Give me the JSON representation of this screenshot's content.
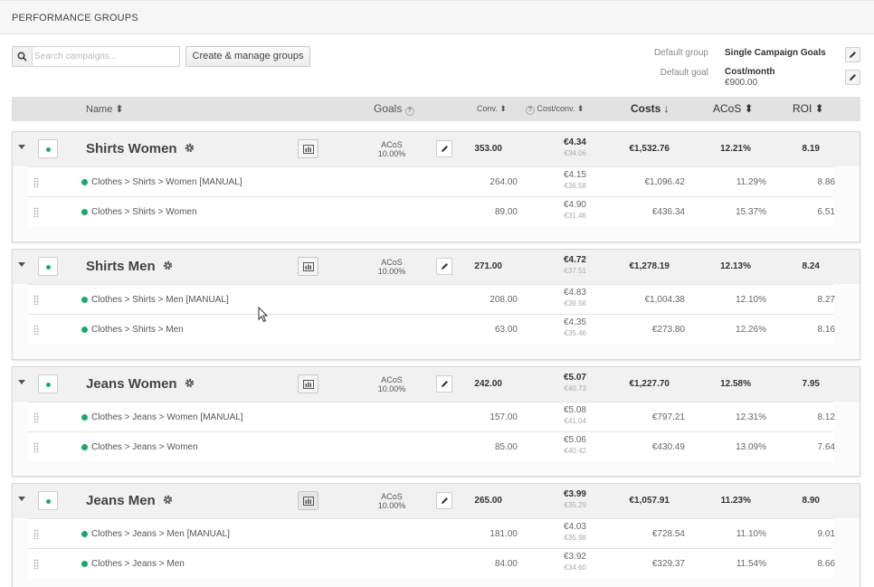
{
  "header": {
    "title": "PERFORMANCE GROUPS"
  },
  "toolbar": {
    "search_placeholder": "Search campaigns...",
    "create_button": "Create & manage groups"
  },
  "defaults": {
    "group_label": "Default group",
    "group_value": "Single Campaign Goals",
    "goal_label": "Default goal",
    "goal_value": "Cost/month",
    "goal_amount": "€900.00"
  },
  "columns": {
    "name": "Name ⬍",
    "goals": "Goals",
    "conv": "Conv. ⬍",
    "cost_conv": "Cost/conv. ⬍",
    "costs": "Costs ↓",
    "acos": "ACoS ⬍",
    "roi": "ROI ⬍"
  },
  "groups": [
    {
      "name": "Shirts Women",
      "goal_label": "ACoS",
      "goal_value": "10.00%",
      "conv": "353.00",
      "cost_conv": "€4.34",
      "cost_conv_sub": "€34.06",
      "costs": "€1,532.76",
      "acos": "12.21%",
      "roi": "8.19",
      "campaigns": [
        {
          "name": "Clothes > Shirts > Women [MANUAL]",
          "conv": "264.00",
          "cost_conv": "€4.15",
          "cost_conv_sub": "€36.58",
          "costs": "€1,096.42",
          "acos": "11.29%",
          "roi": "8.86"
        },
        {
          "name": "Clothes > Shirts > Women",
          "conv": "89.00",
          "cost_conv": "€4.90",
          "cost_conv_sub": "€31.46",
          "costs": "€436.34",
          "acos": "15.37%",
          "roi": "6.51"
        }
      ]
    },
    {
      "name": "Shirts Men",
      "goal_label": "ACoS",
      "goal_value": "10.00%",
      "conv": "271.00",
      "cost_conv": "€4.72",
      "cost_conv_sub": "€37.51",
      "costs": "€1,278.19",
      "acos": "12.13%",
      "roi": "8.24",
      "campaigns": [
        {
          "name": "Clothes > Shirts > Men [MANUAL]",
          "conv": "208.00",
          "cost_conv": "€4.83",
          "cost_conv_sub": "€39.56",
          "costs": "€1,004.38",
          "acos": "12.10%",
          "roi": "8.27"
        },
        {
          "name": "Clothes > Shirts > Men",
          "conv": "63.00",
          "cost_conv": "€4.35",
          "cost_conv_sub": "€35.46",
          "costs": "€273.80",
          "acos": "12.26%",
          "roi": "8.16"
        }
      ]
    },
    {
      "name": "Jeans Women",
      "goal_label": "ACoS",
      "goal_value": "10.00%",
      "conv": "242.00",
      "cost_conv": "€5.07",
      "cost_conv_sub": "€40.73",
      "costs": "€1,227.70",
      "acos": "12.58%",
      "roi": "7.95",
      "campaigns": [
        {
          "name": "Clothes > Jeans > Women [MANUAL]",
          "conv": "157.00",
          "cost_conv": "€5.08",
          "cost_conv_sub": "€41.04",
          "costs": "€797.21",
          "acos": "12.31%",
          "roi": "8.12"
        },
        {
          "name": "Clothes > Jeans > Women",
          "conv": "85.00",
          "cost_conv": "€5.06",
          "cost_conv_sub": "€40.42",
          "costs": "€430.49",
          "acos": "13.09%",
          "roi": "7.64"
        }
      ]
    },
    {
      "name": "Jeans Men",
      "goal_label": "ACoS",
      "goal_value": "10.00%",
      "conv": "265.00",
      "cost_conv": "€3.99",
      "cost_conv_sub": "€35.29",
      "costs": "€1,057.91",
      "acos": "11.23%",
      "roi": "8.90",
      "campaigns": [
        {
          "name": "Clothes > Jeans > Men [MANUAL]",
          "conv": "181.00",
          "cost_conv": "€4.03",
          "cost_conv_sub": "€35.98",
          "costs": "€728.54",
          "acos": "11.10%",
          "roi": "9.01"
        },
        {
          "name": "Clothes > Jeans > Men",
          "conv": "84.00",
          "cost_conv": "€3.92",
          "cost_conv_sub": "€34.60",
          "costs": "€329.37",
          "acos": "11.54%",
          "roi": "8.66"
        }
      ]
    }
  ],
  "colors": {
    "status_active": "#1aa86b",
    "header_bg": "#e2e2e2",
    "group_bg": "#f1f1f1"
  },
  "icons": [
    "search-icon",
    "edit-icon",
    "caret-down-icon",
    "gear-icon",
    "chart-icon",
    "drag-handle-icon",
    "help-icon",
    "mouse-cursor-icon"
  ]
}
